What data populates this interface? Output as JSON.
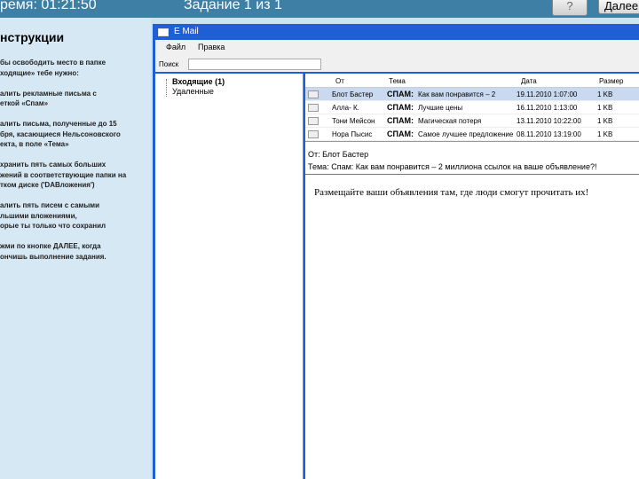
{
  "header": {
    "time_text": "ремя:  01:21:50",
    "task_text": "Задание 1 из 1",
    "help_label": "?",
    "next_label": "Далее"
  },
  "instructions": {
    "title": "нструкции",
    "lines": [
      "бы освободить место в папке",
      "ходящие» тебе нужно:",
      "",
      "алить рекламные письма с",
      "еткой «Спам»",
      "",
      "алить письма, полученные до 15",
      "бря, касающиеся Нельсоновского",
      "екта, в поле «Тема»",
      "",
      "хранить пять самых больших",
      "жений в соответствующие папки на",
      "тком диске ('DAВложения')",
      "",
      "алить пять писем с самыми",
      "льшими вложениями,",
      "орые ты только что сохранил",
      "",
      "жми по кнопке ДАЛЕЕ, когда",
      "ончишь выполнение задания."
    ]
  },
  "window": {
    "title": "E Mail",
    "menu": [
      "Файл",
      "Правка"
    ],
    "search_label": "Поиск",
    "search_value": ""
  },
  "folders": {
    "items": [
      "Входящие (1)",
      "Удаленные"
    ]
  },
  "messages": {
    "columns": [
      "От",
      "Тема",
      "Дата",
      "Размер"
    ],
    "rows": [
      {
        "from": "Блот Бастер",
        "tag": "СПАМ:",
        "subject": "Как вам понравится – 2",
        "date": "19.11.2010 1:07:00",
        "size": "1 KB",
        "selected": true
      },
      {
        "from": "Алла- К.",
        "tag": "СПАМ:",
        "subject": "Лучшие цены",
        "date": "16.11.2010 1:13:00",
        "size": "1 KB",
        "selected": false
      },
      {
        "from": "Тони Мейсон",
        "tag": "СПАМ:",
        "subject": "Магическая потеря",
        "date": "13.11.2010 10:22:00",
        "size": "1 KB",
        "selected": false
      },
      {
        "from": "Нора Пысис",
        "tag": "СПАМ:",
        "subject": "Самое лучшее предложение",
        "date": "08.11.2010 13:19:00",
        "size": "1 KB",
        "selected": false
      }
    ]
  },
  "preview": {
    "from_line": "От: Блот Бастер",
    "subject_line": "Тема: Спам: Как вам понравится – 2 миллиона ссылок на ваше объявление?!",
    "body": "Размещайте ваши объявления там, где люди смогут прочитать их!"
  }
}
